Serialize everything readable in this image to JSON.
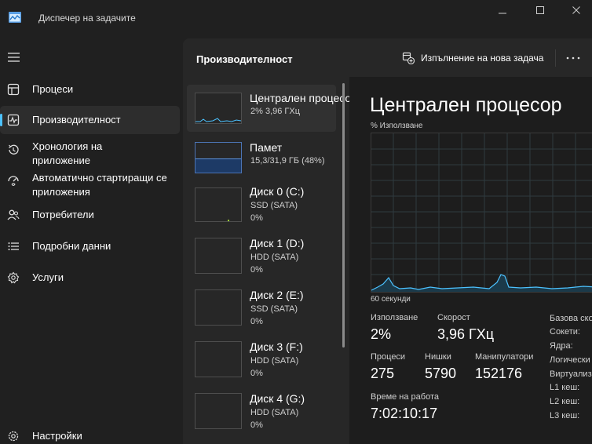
{
  "window": {
    "title": "Диспечер на задачите",
    "icons": {
      "app": "task-manager-icon",
      "minimize": "minimize-icon",
      "maximize": "maximize-icon",
      "close": "close-icon"
    }
  },
  "nav": {
    "items": [
      {
        "label": "Процеси",
        "icon": "processes-icon"
      },
      {
        "label": "Производителност",
        "icon": "performance-icon",
        "active": true
      },
      {
        "label": "Хронология на приложение",
        "icon": "history-icon"
      },
      {
        "label": "Автоматично стартиращи се приложения",
        "icon": "startup-icon"
      },
      {
        "label": "Потребители",
        "icon": "users-icon"
      },
      {
        "label": "Подробни данни",
        "icon": "details-icon"
      },
      {
        "label": "Услуги",
        "icon": "services-icon"
      }
    ],
    "settings": {
      "label": "Настройки",
      "icon": "settings-icon"
    }
  },
  "main": {
    "title": "Производителност",
    "run_task_label": "Изпълнение на нова задача",
    "accent_color": "#4cc2ff"
  },
  "devices": [
    {
      "name": "Централен процесор",
      "sub1": "2% 3,96 ГХц",
      "selected": true
    },
    {
      "name": "Памет",
      "sub1": "15,3/31,9 ГБ (48%)"
    },
    {
      "name": "Диск 0 (C:)",
      "sub1": "SSD (SATA)",
      "sub2": "0%"
    },
    {
      "name": "Диск 1 (D:)",
      "sub1": "HDD (SATA)",
      "sub2": "0%"
    },
    {
      "name": "Диск 2 (E:)",
      "sub1": "SSD (SATA)",
      "sub2": "0%"
    },
    {
      "name": "Диск 3 (F:)",
      "sub1": "HDD (SATA)",
      "sub2": "0%"
    },
    {
      "name": "Диск 4 (G:)",
      "sub1": "HDD (SATA)",
      "sub2": "0%"
    }
  ],
  "detail": {
    "title": "Централен процесор",
    "usage_label": "% Използване",
    "time_label": "60 секунди",
    "graph_color": "#4cc2ff",
    "stats": {
      "usage_label": "Използване",
      "usage_value": "2%",
      "speed_label": "Скорост",
      "speed_value": "3,96 ГХц",
      "processes_label": "Процеси",
      "processes_value": "275",
      "threads_label": "Нишки",
      "threads_value": "5790",
      "handles_label": "Манипулатори",
      "handles_value": "152176",
      "uptime_label": "Време на работа",
      "uptime_value": "7:02:10:17"
    },
    "side": {
      "base_speed": "Базова ско",
      "sockets": "Сокети:",
      "cores": "Ядра:",
      "logical": "Логически",
      "virtualization": "Виртуализ",
      "l1": "L1 кеш:",
      "l2": "L2 кеш:",
      "l3": "L3 кеш:"
    }
  }
}
